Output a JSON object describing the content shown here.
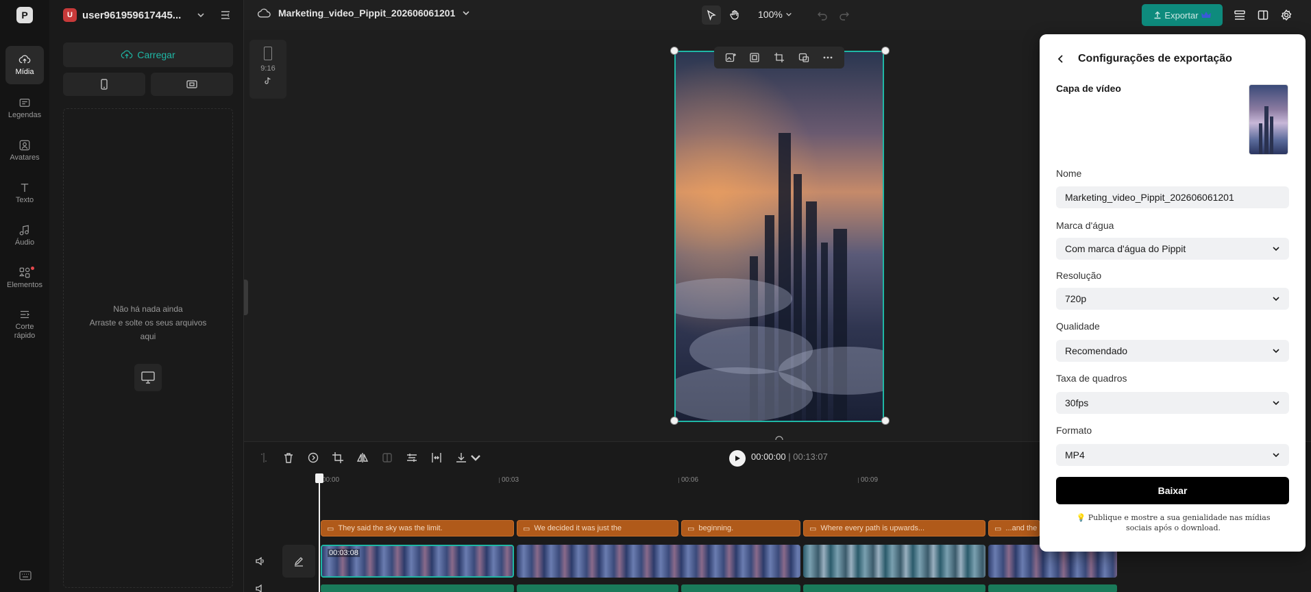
{
  "nav": {
    "items": [
      {
        "label": "Mídia",
        "icon": "cloud-upload-icon"
      },
      {
        "label": "Legendas",
        "icon": "captions-icon"
      },
      {
        "label": "Avatares",
        "icon": "avatar-icon"
      },
      {
        "label": "Texto",
        "icon": "text-icon"
      },
      {
        "label": "Áudio",
        "icon": "music-icon"
      },
      {
        "label": "Elementos",
        "icon": "elements-icon"
      },
      {
        "label": "Corte rápido",
        "icon": "quick-cut-icon"
      }
    ]
  },
  "user": {
    "initial": "U",
    "name": "user961959617445..."
  },
  "media": {
    "upload_label": "Carregar",
    "empty_line1": "Não há nada ainda",
    "empty_line2": "Arraste e solte os seus arquivos aqui"
  },
  "topbar": {
    "project_name": "Marketing_video_Pippit_202606061201",
    "zoom": "100%",
    "export_label": "Exportar"
  },
  "canvas": {
    "ratio_label": "9:16"
  },
  "timeline": {
    "current_time": "00:00:00",
    "total_time": "00:13:07",
    "ruler": [
      "00:00",
      "00:03",
      "00:06",
      "00:09"
    ],
    "captions": [
      "They said the sky was the limit.",
      "We decided it was just the",
      "beginning.",
      "Where every path is upwards...",
      "...and the"
    ],
    "clip_time": "00:03:08"
  },
  "export_panel": {
    "title": "Configurações de exportação",
    "cover_label": "Capa de vídeo",
    "name_label": "Nome",
    "name_value": "Marketing_video_Pippit_202606061201",
    "watermark_label": "Marca d'água",
    "watermark_value": "Com marca d'água do Pippit",
    "resolution_label": "Resolução",
    "resolution_value": "720p",
    "quality_label": "Qualidade",
    "quality_value": "Recomendado",
    "fps_label": "Taxa de quadros",
    "fps_value": "30fps",
    "format_label": "Formato",
    "format_value": "MP4",
    "download_label": "Baixar",
    "hint": "Publique e mostre a sua genialidade nas mídias sociais após o download."
  },
  "colors": {
    "accent": "#1fb8a6",
    "caption_clip": "#b05a1a",
    "export_btn": "#0e8b7d"
  }
}
